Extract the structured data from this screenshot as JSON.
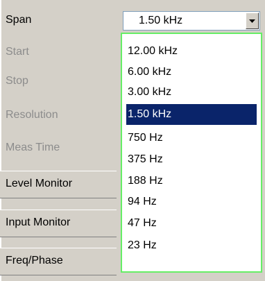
{
  "labels": {
    "span": "Span",
    "start": "Start",
    "stop": "Stop",
    "resolution": "Resolution",
    "meas_time": "Meas Time"
  },
  "groups": {
    "level_monitor": "Level Monitor",
    "input_monitor": "Input Monitor",
    "freq_phase": "Freq/Phase"
  },
  "span_combo": {
    "value": "1.50 kHz",
    "options": [
      "12.00 kHz",
      "6.00 kHz",
      "3.00 kHz",
      "1.50 kHz",
      "750 Hz",
      "375 Hz",
      "188 Hz",
      "94 Hz",
      "47 Hz",
      "23 Hz"
    ],
    "selected_index": 3
  },
  "colors": {
    "panel_bg": "#d4d0c8",
    "selection_bg": "#0a246a",
    "dropdown_border": "#66ee66",
    "disabled_text": "#8c8c8c"
  }
}
